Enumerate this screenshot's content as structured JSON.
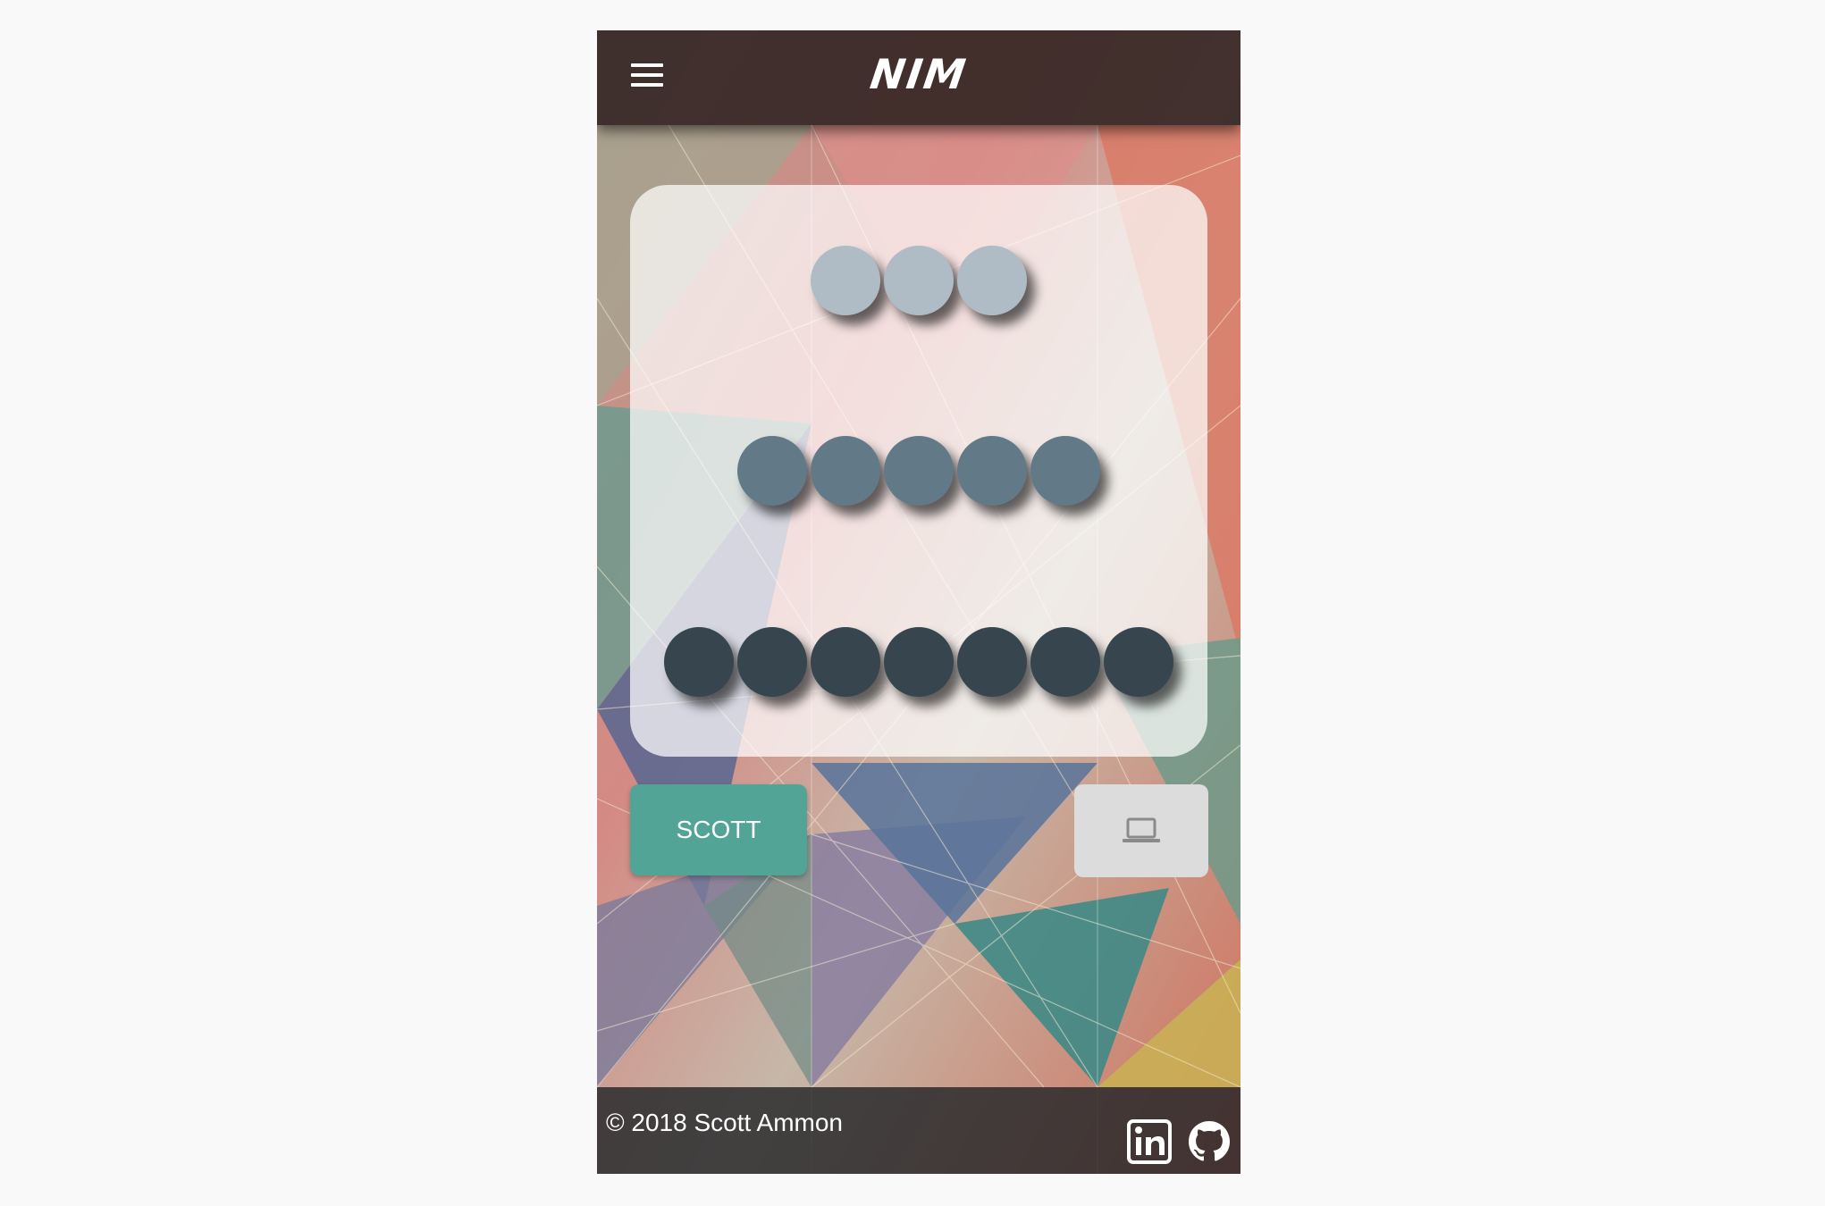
{
  "app": {
    "title": "NIM"
  },
  "board": {
    "piles": [
      {
        "count": 3,
        "color": "#b0bcc5"
      },
      {
        "count": 5,
        "color": "#627a88"
      },
      {
        "count": 7,
        "color": "#36454e"
      }
    ]
  },
  "players": {
    "human_label": "SCOTT",
    "human_color": "#52a497",
    "computer_icon": "laptop-icon"
  },
  "footer": {
    "copyright": "© 2018 Scott Ammon",
    "links": [
      "linkedin-icon",
      "github-icon"
    ]
  }
}
